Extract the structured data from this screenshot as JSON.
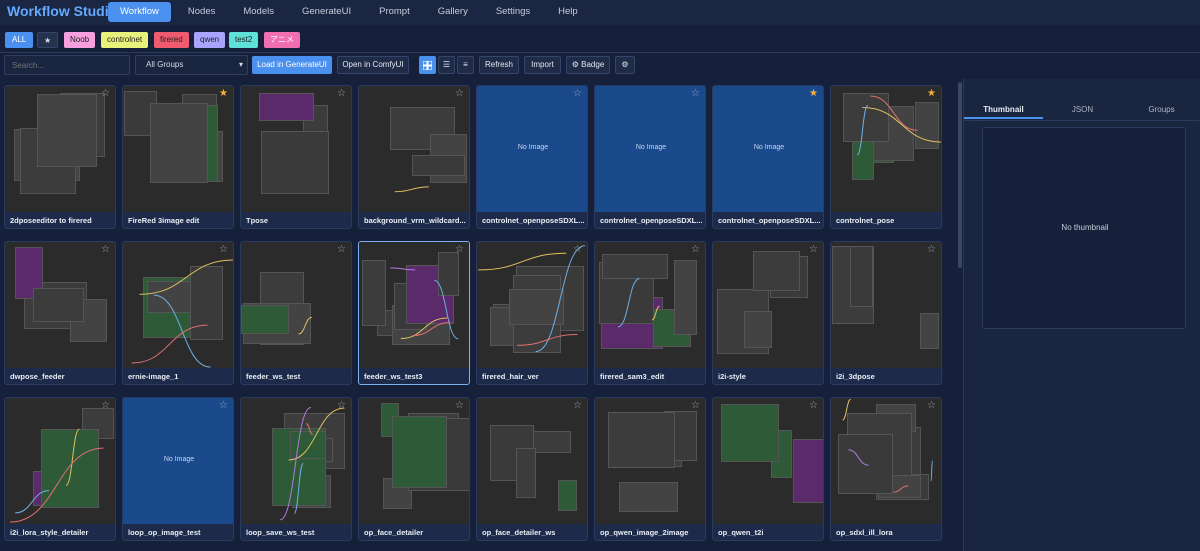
{
  "app_title": "Workflow Studio",
  "nav": [
    {
      "label": "Workflow",
      "active": true
    },
    {
      "label": "Nodes"
    },
    {
      "label": "Models"
    },
    {
      "label": "GenerateUI"
    },
    {
      "label": "Prompt"
    },
    {
      "label": "Gallery"
    },
    {
      "label": "Settings"
    },
    {
      "label": "Help"
    }
  ],
  "tags": [
    {
      "label": "ALL",
      "color": "#4a90ef"
    },
    {
      "label": "★",
      "color": "#25324f"
    },
    {
      "label": "Noob",
      "color": "#f7a0e0"
    },
    {
      "label": "controlnet",
      "color": "#e6f27a"
    },
    {
      "label": "firered",
      "color": "#f05a6e"
    },
    {
      "label": "qwen",
      "color": "#a8a4ff"
    },
    {
      "label": "test2",
      "color": "#5fe0d8"
    },
    {
      "label": "アニメ",
      "color": "#f06fb0"
    }
  ],
  "toolbar": {
    "search_placeholder": "Search...",
    "group_select": "All Groups",
    "load_button": "Load in GenerateUI",
    "open_button": "Open in ComfyUI",
    "refresh_button": "Refresh",
    "import_button": "Import",
    "badge_button": "⚙ Badge",
    "settings_button": "⚙",
    "view_grid_icon": "grid-view-icon",
    "view_list_icon": "list-view-icon",
    "view_compact_icon": "compact-list-icon"
  },
  "cards": [
    {
      "label": "2dposeeditor to firered",
      "favorite": false,
      "no_image": false
    },
    {
      "label": "FireRed 3image edit",
      "favorite": true,
      "no_image": false
    },
    {
      "label": "Tpose",
      "favorite": false,
      "no_image": false
    },
    {
      "label": "background_vrm_wildcard...",
      "favorite": false,
      "no_image": false
    },
    {
      "label": "controlnet_openposeSDXL...",
      "favorite": false,
      "no_image": true
    },
    {
      "label": "controlnet_openposeSDXL...",
      "favorite": false,
      "no_image": true
    },
    {
      "label": "controlnet_openposeSDXL...",
      "favorite": true,
      "no_image": true
    },
    {
      "label": "controlnet_pose",
      "favorite": true,
      "no_image": false
    },
    {
      "label": "dwpose_feeder",
      "favorite": false,
      "no_image": false
    },
    {
      "label": "ernie-image_1",
      "favorite": false,
      "no_image": false
    },
    {
      "label": "feeder_ws_test",
      "favorite": false,
      "no_image": false
    },
    {
      "label": "feeder_ws_test3",
      "favorite": false,
      "no_image": false,
      "selected": true
    },
    {
      "label": "firered_hair_ver",
      "favorite": false,
      "no_image": false
    },
    {
      "label": "firered_sam3_edit",
      "favorite": false,
      "no_image": false
    },
    {
      "label": "i2i-style",
      "favorite": false,
      "no_image": false
    },
    {
      "label": "i2i_3dpose",
      "favorite": false,
      "no_image": false
    },
    {
      "label": "i2i_lora_style_detailer",
      "favorite": false,
      "no_image": false
    },
    {
      "label": "loop_op_image_test",
      "favorite": false,
      "no_image": true
    },
    {
      "label": "loop_save_ws_test",
      "favorite": false,
      "no_image": false
    },
    {
      "label": "op_face_detailer",
      "favorite": false,
      "no_image": false
    },
    {
      "label": "op_face_detailer_ws",
      "favorite": false,
      "no_image": false
    },
    {
      "label": "op_qwen_image_2image",
      "favorite": false,
      "no_image": false
    },
    {
      "label": "op_qwen_t2i",
      "favorite": false,
      "no_image": false
    },
    {
      "label": "op_sdxl_ill_lora",
      "favorite": false,
      "no_image": false
    }
  ],
  "no_image_text": "No Image",
  "panel": {
    "tabs": [
      {
        "label": "Thumbnail",
        "active": true
      },
      {
        "label": "JSON"
      },
      {
        "label": "Groups"
      }
    ],
    "no_thumbnail_text": "No thumbnail"
  }
}
